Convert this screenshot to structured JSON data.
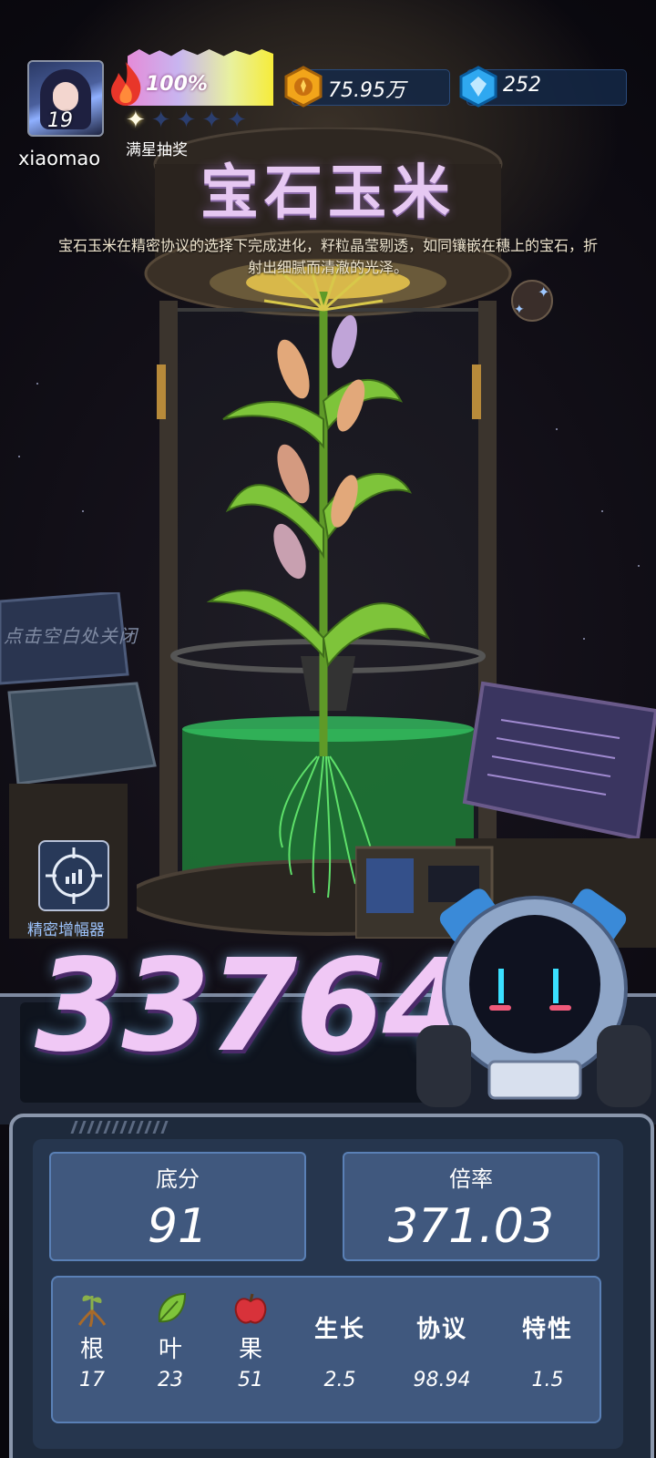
{
  "player": {
    "name": "xiaomao",
    "level": "19"
  },
  "progress": {
    "percent_label": "100%",
    "fill": 1.0,
    "stars_filled": 1,
    "stars_total": 5,
    "label": "满星抽奖"
  },
  "currency": {
    "gold": "75.95万",
    "gems": "252"
  },
  "item": {
    "title": "宝石玉米",
    "description": "宝石玉米在精密协议的选择下完成进化，籽粒晶莹剔透，如同镶嵌在穗上的宝石，折射出细腻而清澈的光泽。"
  },
  "hint": "点击空白处关闭",
  "amplifier": {
    "label": "精密增幅器",
    "icon": "target-chart-icon"
  },
  "score": {
    "total": "33764",
    "base_label": "底分",
    "base": "91",
    "rate_label": "倍率",
    "rate": "371.03"
  },
  "stats": [
    {
      "name": "根",
      "icon": "root-icon",
      "value": "17"
    },
    {
      "name": "叶",
      "icon": "leaf-icon",
      "value": "23"
    },
    {
      "name": "果",
      "icon": "apple-icon",
      "value": "51"
    },
    {
      "name": "生长",
      "value": "2.5"
    },
    {
      "name": "协议",
      "value": "98.94"
    },
    {
      "name": "特性",
      "value": "1.5"
    }
  ],
  "colors": {
    "accent_purple": "#e6c8f2",
    "panel_blue": "#40587e",
    "gold": "#f2a51a",
    "gem": "#2fa8f0"
  }
}
